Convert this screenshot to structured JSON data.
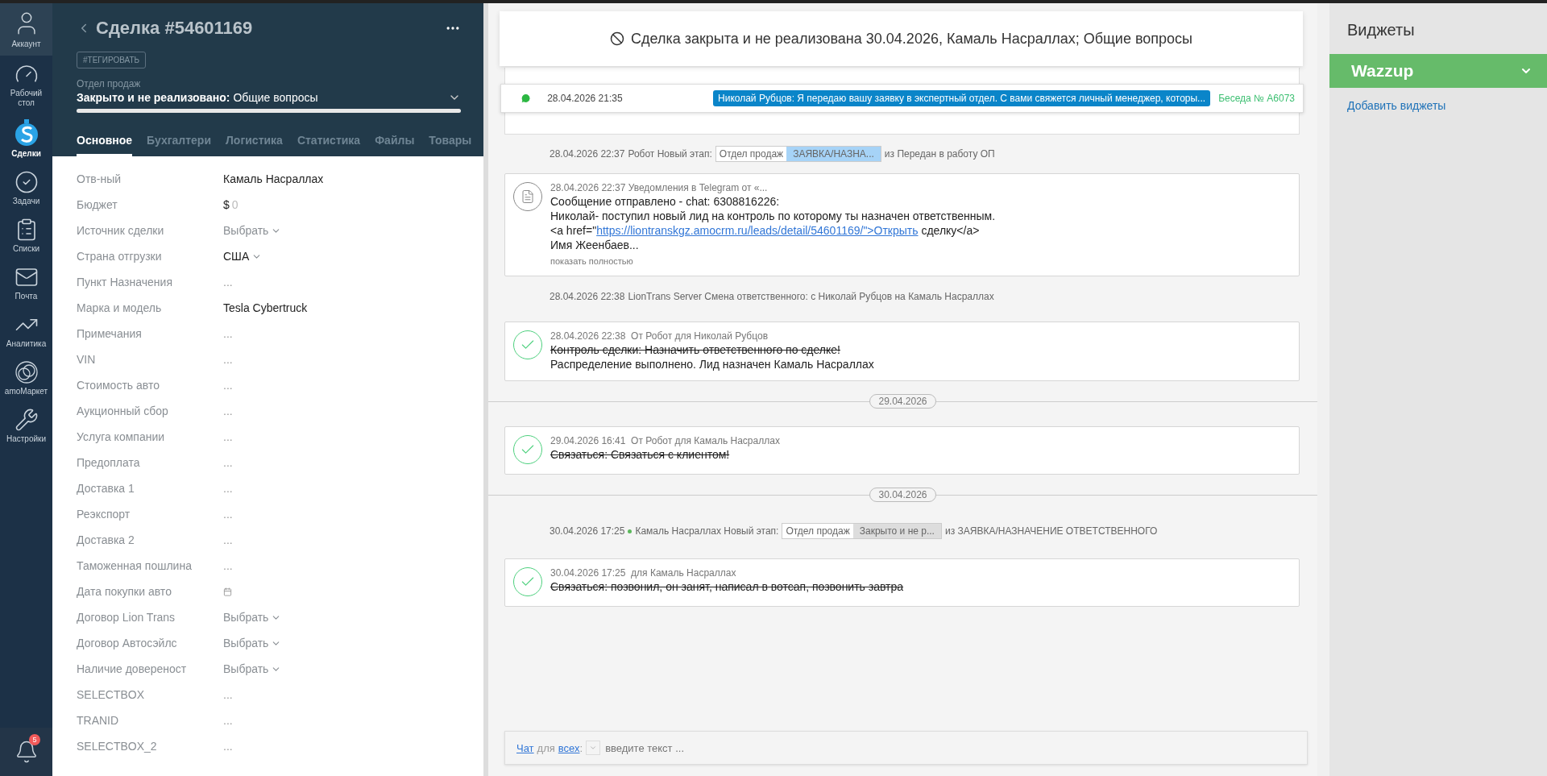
{
  "nav": {
    "account": "Аккаунт",
    "items": [
      {
        "kind": "dashboard",
        "label": "Рабочий стол",
        "selected": false
      },
      {
        "kind": "deals",
        "label": "Сделки",
        "selected": true
      },
      {
        "kind": "tasks",
        "label": "Задачи",
        "selected": false
      },
      {
        "kind": "lists",
        "label": "Списки",
        "selected": false
      },
      {
        "kind": "mail",
        "label": "Почта",
        "selected": false
      },
      {
        "kind": "analytics",
        "label": "Аналитика",
        "selected": false
      },
      {
        "kind": "market",
        "label": "amoМаркет",
        "selected": false
      },
      {
        "kind": "settings",
        "label": "Настройки",
        "selected": false
      }
    ],
    "notifications": "5"
  },
  "deal": {
    "title": "Сделка #54601169",
    "tag_button": "#ТЕГИРОВАТЬ",
    "pipeline": "Отдел продаж",
    "status": "Закрыто и не реализовано:",
    "status_reason": "Общие вопросы",
    "progress": {
      "level": 1
    },
    "tabs": [
      {
        "label": "Основное",
        "selected": true
      },
      {
        "label": "Бухгалтери",
        "selected": false
      },
      {
        "label": "Логистика",
        "selected": false
      },
      {
        "label": "Статистика",
        "selected": false
      },
      {
        "label": "Файлы",
        "selected": false
      },
      {
        "label": "Товары",
        "selected": false
      }
    ],
    "fields": [
      {
        "label": "Отв-ный",
        "kind": "text",
        "value": "Камаль Насраллах"
      },
      {
        "label": "Бюджет",
        "kind": "money",
        "currency": "$",
        "value": "0"
      },
      {
        "label": "Источник сделки",
        "kind": "select",
        "value": "Выбрать"
      },
      {
        "label": "Страна отгрузки",
        "kind": "select_set",
        "value": "США"
      },
      {
        "label": "Пункт Назначения",
        "kind": "empty",
        "value": "..."
      },
      {
        "label": "Марка и модель",
        "kind": "text",
        "value": "Tesla Cybertruck"
      },
      {
        "label": "Примечания",
        "kind": "empty",
        "value": "..."
      },
      {
        "label": "VIN",
        "kind": "empty",
        "value": "..."
      },
      {
        "label": "Стоимость авто",
        "kind": "empty",
        "value": "..."
      },
      {
        "label": "Аукционный сбор",
        "kind": "empty",
        "value": "..."
      },
      {
        "label": "Услуга компании",
        "kind": "empty",
        "value": "..."
      },
      {
        "label": "Предоплата",
        "kind": "empty",
        "value": "..."
      },
      {
        "label": "Доставка 1",
        "kind": "empty",
        "value": "..."
      },
      {
        "label": "Реэкспорт",
        "kind": "empty",
        "value": "..."
      },
      {
        "label": "Доставка 2",
        "kind": "empty",
        "value": "..."
      },
      {
        "label": "Таможенная пошлина",
        "kind": "empty",
        "value": "..."
      },
      {
        "label": "Дата покупки авто",
        "kind": "date"
      },
      {
        "label": "Договор Lion Trans",
        "kind": "select",
        "value": "Выбрать"
      },
      {
        "label": "Договор Автосэйлс",
        "kind": "select",
        "value": "Выбрать"
      },
      {
        "label": "Наличие довереност",
        "kind": "select",
        "value": "Выбрать"
      },
      {
        "label": "SELECTBOX",
        "kind": "empty",
        "value": "..."
      },
      {
        "label": "TRANID",
        "kind": "empty",
        "value": "..."
      },
      {
        "label": "SELECTBOX_2",
        "kind": "empty",
        "value": "..."
      }
    ]
  },
  "feed": {
    "banner": "Сделка закрыта и не реализована 30.04.2026, Камаль Насраллах; Общие вопросы",
    "whatsapp": {
      "time": "28.04.2026 21:35",
      "message": "Николай Рубцов: Я передаю вашу заявку в экспертный отдел. С вами свяжется личный менеджер, которы...",
      "conversation": "Беседа № А6073"
    },
    "events": [
      {
        "kind": "system",
        "time": "28.04.2026 22:37",
        "online": false,
        "text": "Робот Новый этап:",
        "stage": {
          "pipeline": "Отдел продаж",
          "name": "ЗАЯВКА/НАЗНА...",
          "color": "#a6d3f7"
        },
        "tail": "из Передан в работу ОП"
      },
      {
        "kind": "note",
        "header": "28.04.2026 22:37 Уведомления в Telegram от «...",
        "lines": [
          {
            "text": "Сообщение отправлено - chat: 6308816226:"
          },
          {
            "text": "Николай- поступил новый лид на контроль по которому ты назначен ответственным."
          },
          {
            "text": "<a href=\"",
            "link": "https://liontranskgz.amocrm.ru/leads/detail/54601169/\">Открыть",
            "after": " сделку</a>"
          },
          {
            "text": "Имя Жеенбаев..."
          }
        ],
        "more": "показать полностью"
      },
      {
        "kind": "system",
        "time": "28.04.2026 22:38",
        "online": false,
        "text": "LionTrans Server Смена ответственного: с Николай Рубцов на Камаль Насраллах"
      },
      {
        "kind": "task",
        "time": "28.04.2026 22:38",
        "meta": "От Робот для Николай Рубцов",
        "lines": [
          {
            "text": "Контроль сделки: Назначить ответственного по сделке!",
            "done": true
          },
          {
            "text": "Распределение выполнено. Лид назначен Камаль Насраллах",
            "done": false
          }
        ]
      },
      {
        "kind": "divider",
        "date": "29.04.2026"
      },
      {
        "kind": "task",
        "time": "29.04.2026 16:41",
        "meta": "От Робот для Камаль Насраллах",
        "lines": [
          {
            "text": "Связаться: Связаться с клиентом!",
            "done": true
          }
        ]
      },
      {
        "kind": "divider",
        "date": "30.04.2026"
      },
      {
        "kind": "system",
        "time": "30.04.2026 17:25",
        "online": true,
        "text": "Камаль Насраллах Новый этап:",
        "stage": {
          "pipeline": "Отдел продаж",
          "name": "Закрыто и не р...",
          "color": "#dddddd"
        },
        "tail": "из ЗАЯВКА/НАЗНАЧЕНИЕ ОТВЕТСТВЕННОГО"
      },
      {
        "kind": "task",
        "time": "30.04.2026 17:25",
        "meta": "для Камаль Насраллах",
        "lines": [
          {
            "text": "Связаться: позвонил, он занят, написал в вотсап, позвонить завтра",
            "done": true
          }
        ]
      }
    ],
    "chat": {
      "mode": "Чат",
      "for": "для",
      "audience": "всех",
      "colon": ":",
      "placeholder": "введите текст ..."
    }
  },
  "widgets": {
    "title": "Виджеты",
    "items": [
      {
        "name": "Wazzup"
      }
    ],
    "add_link": "Добавить виджеты"
  }
}
